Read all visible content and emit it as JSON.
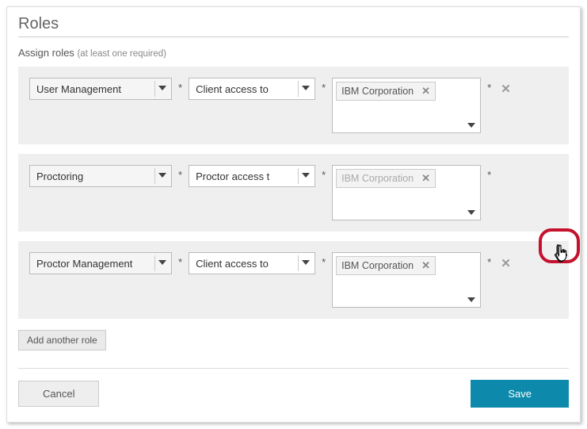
{
  "title": "Roles",
  "subtitle": {
    "main": "Assign roles",
    "hint": "(at least one required)"
  },
  "rows": [
    {
      "role": "User Management",
      "access": "Client access to",
      "tag": "IBM Corporation",
      "tagDisabled": false,
      "showRemove": true
    },
    {
      "role": "Proctoring",
      "access": "Proctor access t",
      "tag": "IBM Corporation",
      "tagDisabled": true,
      "showRemove": false
    },
    {
      "role": "Proctor Management",
      "access": "Client access to",
      "tag": "IBM Corporation",
      "tagDisabled": false,
      "showRemove": true
    }
  ],
  "addAnother": "Add another role",
  "cancel": "Cancel",
  "save": "Save"
}
